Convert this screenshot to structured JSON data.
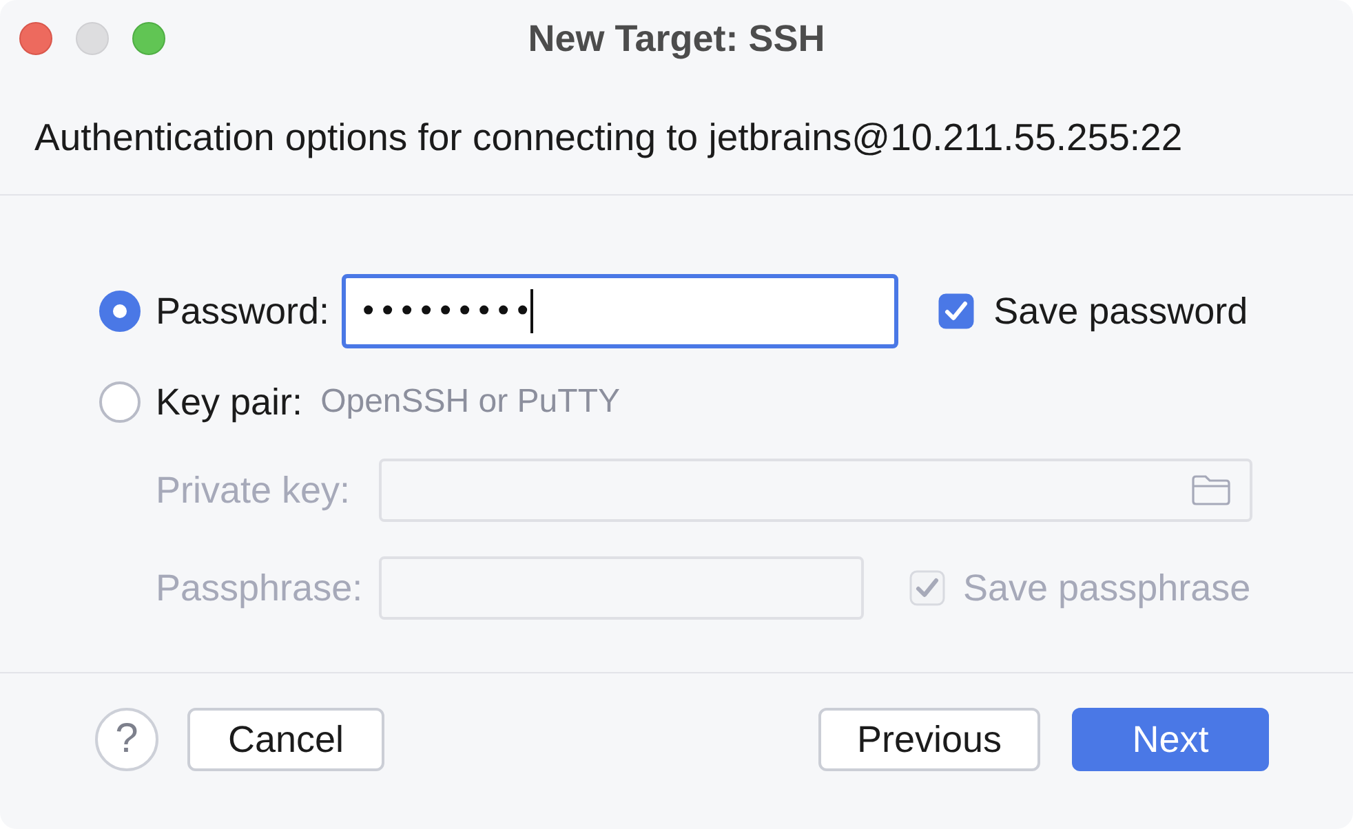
{
  "window": {
    "title": "New Target: SSH",
    "controls": [
      {
        "kind": "close",
        "disabled": false
      },
      {
        "kind": "minimize",
        "disabled": true
      },
      {
        "kind": "zoom",
        "disabled": false
      }
    ]
  },
  "header": {
    "text": "Authentication options for connecting to jetbrains@10.211.55.255:22"
  },
  "authentication_options": [
    {
      "kind": "password",
      "label": "Password:",
      "selected": true,
      "field": {
        "value": "•••••••••",
        "focused": true
      },
      "checkbox": {
        "label": "Save password",
        "checked": true,
        "disabled": false
      }
    },
    {
      "kind": "key_pair",
      "label": "Key pair:",
      "hint": "OpenSSH or PuTTY",
      "selected": false,
      "private_key": {
        "label": "Private key:",
        "disabled": true
      },
      "passphrase": {
        "label": "Passphrase:",
        "disabled": true
      },
      "checkbox": {
        "label": "Save passphrase",
        "checked": true,
        "disabled": true
      }
    }
  ],
  "footer": {
    "help_button": {
      "label": "?"
    },
    "cancel_button": {
      "label": "Cancel",
      "kind": "secondary"
    },
    "previous_button": {
      "label": "Previous",
      "kind": "secondary"
    },
    "next_button": {
      "label": "Next",
      "kind": "primary"
    }
  }
}
